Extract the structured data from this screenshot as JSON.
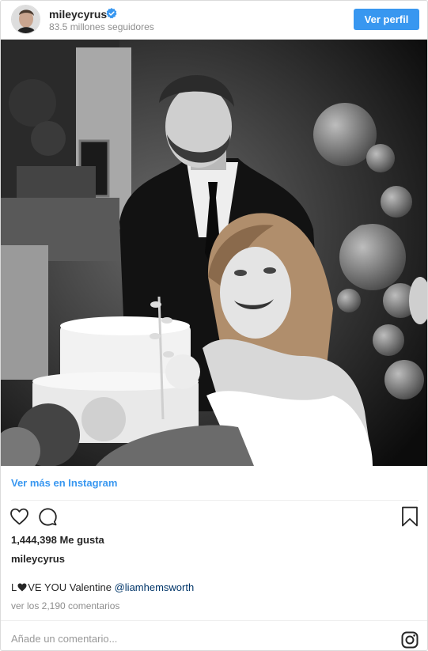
{
  "header": {
    "username": "mileycyrus",
    "followers": "83.5 millones seguidores",
    "view_profile_label": "Ver perfil",
    "verified_icon": "verified-badge-icon"
  },
  "post": {
    "more_on_instagram": "Ver más en Instagram",
    "likes": "1,444,398 Me gusta",
    "caption_user": "mileycyrus",
    "caption_before": "L",
    "caption_after": "VE YOU Valentine ",
    "caption_mention": "@liamhemsworth",
    "view_comments": "ver los 2,190 comentarios",
    "comment_placeholder": "Añade un comentario..."
  },
  "icons": {
    "like": "heart-icon",
    "comment": "comment-bubble-icon",
    "save": "bookmark-icon",
    "instagram": "instagram-logo-icon"
  },
  "colors": {
    "accent": "#3897f0",
    "text": "#262626",
    "secondary_text": "#8e8e8e",
    "mention": "#003569"
  }
}
